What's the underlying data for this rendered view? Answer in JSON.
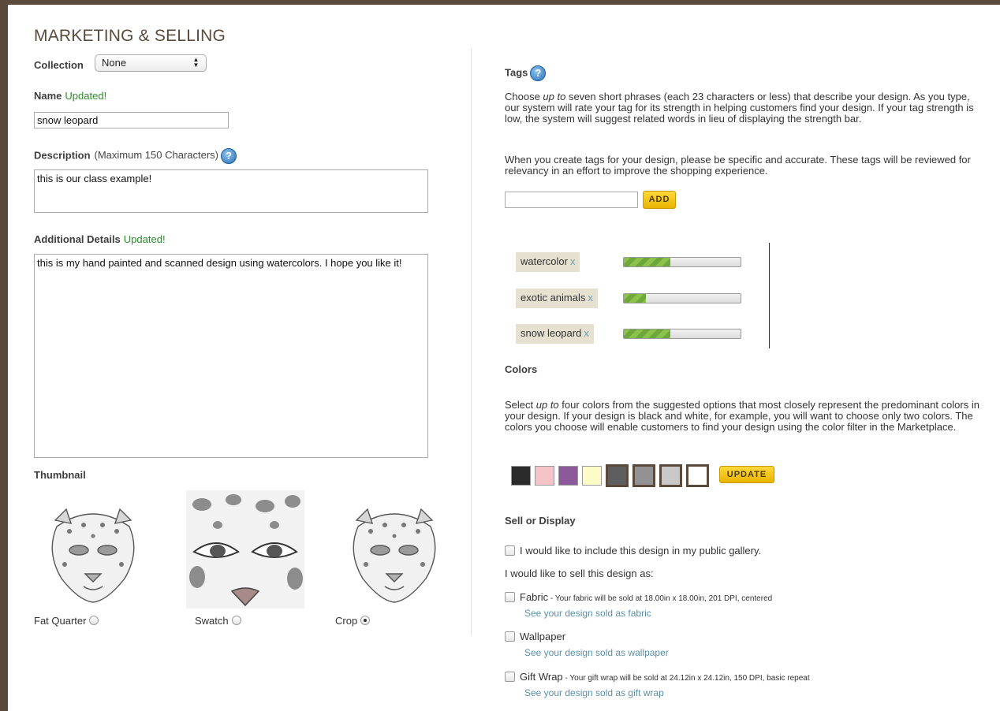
{
  "section_title": "MARKETING & SELLING",
  "collection": {
    "label": "Collection",
    "value": "None",
    "arrows": "▲▼"
  },
  "name": {
    "label": "Name",
    "status": "Updated!",
    "value": "snow leopard"
  },
  "description": {
    "label": "Description",
    "note": "(Maximum 150 Characters)",
    "value": "this is our class example!"
  },
  "additional_details": {
    "label": "Additional Details",
    "status": "Updated!",
    "value": "this is my hand painted and scanned design using watercolors. I hope you like it!"
  },
  "thumbnail": {
    "label": "Thumbnail",
    "options": [
      {
        "label": "Fat Quarter",
        "selected": false
      },
      {
        "label": "Swatch",
        "selected": false
      },
      {
        "label": "Crop",
        "selected": true
      }
    ]
  },
  "help_glyph": "?",
  "tags": {
    "heading": "Tags",
    "intro_parts": [
      "Choose ",
      "up to",
      " seven short phrases (each 23 characters or less) that describe your design. As you type, our system will rate your tag for its strength in helping customers find your design. If your tag strength is low, the system will suggest related words in lieu of displaying the strength bar."
    ],
    "guidance": "When you create tags for your design, please be specific and accurate. These tags will be reviewed for relevancy in an effort to improve the shopping experience.",
    "input_value": "",
    "add_label": "ADD",
    "remove_glyph": "x",
    "items": [
      {
        "text": "watercolor",
        "strength": 0.4
      },
      {
        "text": "exotic animals",
        "strength": 0.19
      },
      {
        "text": "snow leopard",
        "strength": 0.4
      }
    ]
  },
  "colors": {
    "heading": "Colors",
    "intro_parts": [
      "Select ",
      "up to",
      " four colors from the suggested options that most closely represent the predominant colors in your design. If your design is black and white, for example, you will want to choose only two colors. The colors you choose will enable customers to find your design using the color filter in the Marketplace."
    ],
    "swatches": [
      {
        "color": "#2b2b2b",
        "selected": false
      },
      {
        "color": "#f6c4c8",
        "selected": false
      },
      {
        "color": "#8c5a9a",
        "selected": false
      },
      {
        "color": "#fdfbc8",
        "selected": false
      },
      {
        "color": "#5e5e5e",
        "selected": true
      },
      {
        "color": "#929292",
        "selected": true
      },
      {
        "color": "#c8c8c8",
        "selected": true
      },
      {
        "color": "#ffffff",
        "selected": true
      }
    ],
    "update_label": "UPDATE"
  },
  "sell": {
    "heading": "Sell or Display",
    "gallery_option": "I would like to include this design in my public gallery.",
    "sell_as_label": "I would like to sell this design as:",
    "fabric": {
      "label": "Fabric",
      "detail": " - Your fabric will be sold at 18.00in x 18.00in, 201 DPI, centered",
      "link": "See your design sold as fabric"
    },
    "wallpaper": {
      "label": "Wallpaper",
      "link": "See your design sold as wallpaper"
    },
    "giftwrap": {
      "label": "Gift Wrap",
      "detail": " - Your gift wrap will be sold at 24.12in x 24.12in, 150 DPI, basic repeat",
      "link": "See your design sold as gift wrap"
    }
  }
}
